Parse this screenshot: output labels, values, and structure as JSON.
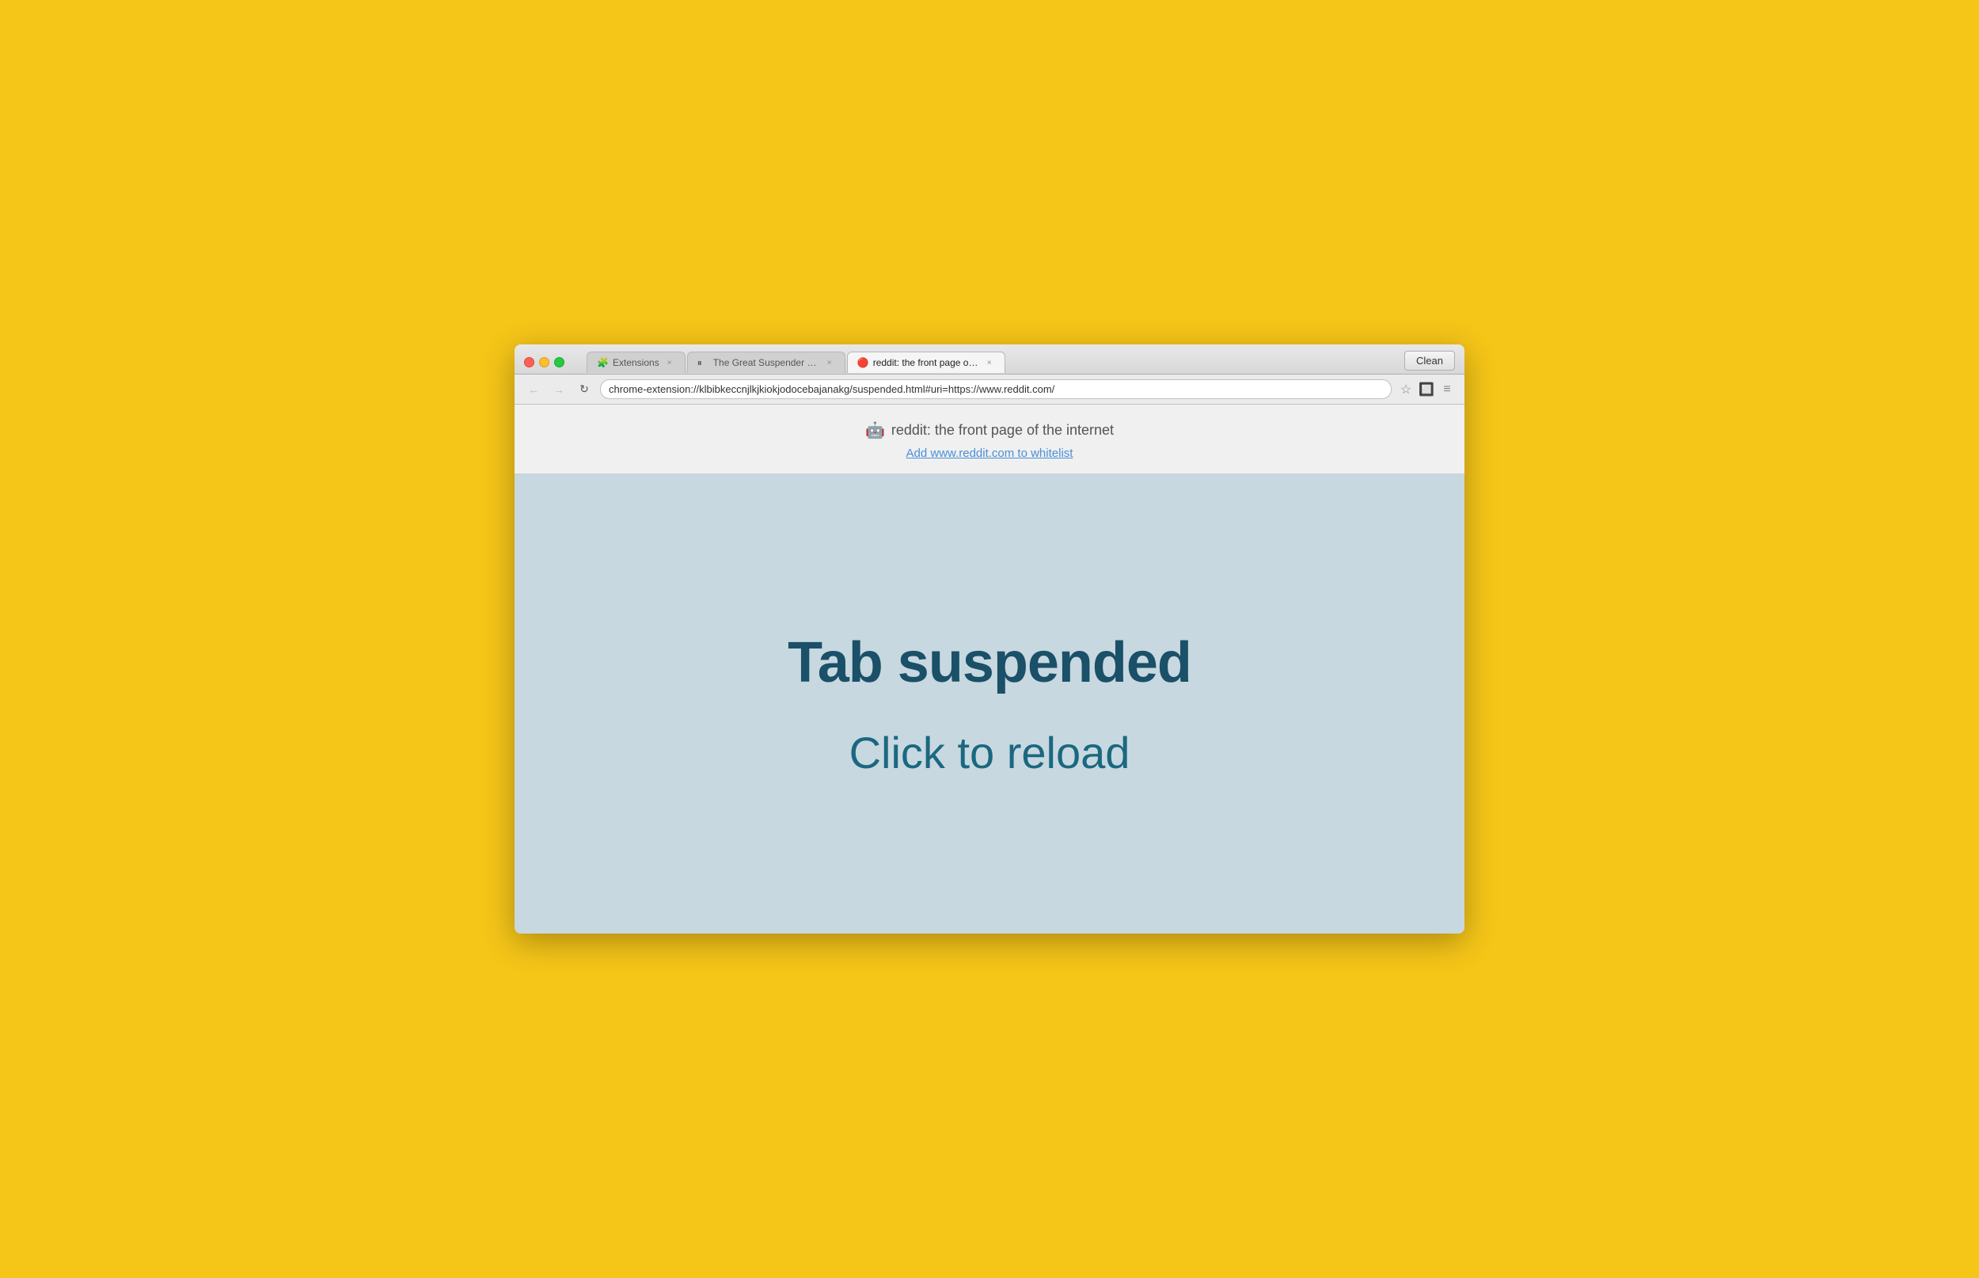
{
  "window": {
    "background": "#F5C518"
  },
  "browser": {
    "clean_button": "Clean",
    "address_url": "chrome-extension://klbibkeccnjlkjkiokjodocebajanakg/suspended.html#uri=https://www.reddit.com/"
  },
  "tabs": [
    {
      "id": "extensions",
      "icon": "🧩",
      "label": "Extensions",
      "active": false,
      "closeable": true
    },
    {
      "id": "great-suspender",
      "icon": "⏸",
      "label": "The Great Suspender - Ch…",
      "active": false,
      "closeable": true
    },
    {
      "id": "reddit",
      "icon": "🔴",
      "label": "reddit: the front page of the…",
      "active": true,
      "closeable": true
    }
  ],
  "page_header": {
    "site_icon": "🤖",
    "site_title": "reddit: the front page of the internet",
    "whitelist_link": "Add www.reddit.com to whitelist"
  },
  "page_content": {
    "suspended_title": "Tab suspended",
    "reload_text": "Click to reload"
  },
  "nav": {
    "back_disabled": true,
    "forward_disabled": true
  }
}
